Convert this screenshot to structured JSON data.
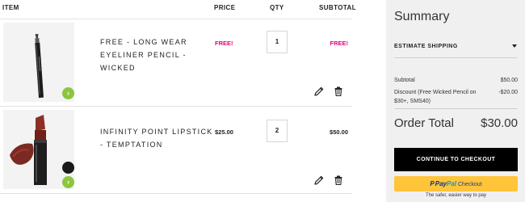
{
  "table": {
    "headers": {
      "item": "ITEM",
      "price": "PRICE",
      "qty": "QTY",
      "subtotal": "SUBTOTAL"
    },
    "items": [
      {
        "name": "FREE - LONG WEAR EYELINER PENCIL - WICKED",
        "price": "FREE!",
        "qty": "1",
        "subtotal": "FREE!",
        "badge_icon": "vegan-leaf-icon"
      },
      {
        "name": "INFINITY POINT LIPSTICK - TEMPTATION",
        "price": "$25.00",
        "qty": "2",
        "subtotal": "$50.00",
        "badge_icon": "vegan-leaf-icon"
      }
    ]
  },
  "summary": {
    "title": "Summary",
    "estimate_shipping": "ESTIMATE SHIPPING",
    "subtotal_label": "Subtotal",
    "subtotal_value": "$50.00",
    "discount_label": "Discount (Free Wicked Pencil on $30+, SMS40)",
    "discount_value": "-$20.00",
    "order_total_label": "Order Total",
    "order_total_value": "$30.00",
    "checkout_label": "CONTINUE TO CHECKOUT",
    "paypal": {
      "brand_pay": "Pay",
      "brand_pal": "Pal",
      "checkout": "Checkout",
      "tagline": "The safer, easier way to pay"
    }
  },
  "colors": {
    "free_text": "#e6007e",
    "badge": "#8cc63f",
    "paypal_button": "#ffc439",
    "checkout_button": "#000000"
  }
}
